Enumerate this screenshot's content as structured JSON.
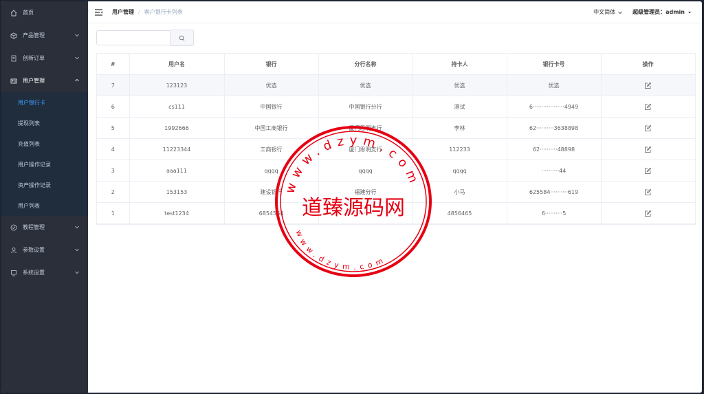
{
  "sidebar": {
    "items": [
      {
        "label": "首页",
        "icon": "home-icon"
      },
      {
        "label": "产品管理",
        "icon": "cube-icon"
      },
      {
        "label": "创新订单",
        "icon": "order-icon"
      },
      {
        "label": "用户管理",
        "icon": "user-card-icon"
      },
      {
        "label": "教程管理",
        "icon": "check-circle-icon"
      },
      {
        "label": "参数设置",
        "icon": "person-icon"
      },
      {
        "label": "系统设置",
        "icon": "monitor-icon"
      }
    ],
    "submenu": [
      "用户银行卡",
      "提现列表",
      "充值列表",
      "用户操作记录",
      "资产操作记录",
      "用户列表"
    ]
  },
  "header": {
    "breadcrumb_parent": "用户管理",
    "breadcrumb_current": "客户银行卡列表",
    "language": "中文简体",
    "admin": "超级管理员：admin"
  },
  "search": {
    "value": "",
    "placeholder": ""
  },
  "table": {
    "headers": [
      "#",
      "用户名",
      "银行",
      "分行名称",
      "持卡人",
      "银行卡号",
      "操作"
    ],
    "rows": [
      [
        "7",
        "123123",
        "优选",
        "优选",
        "优选",
        "优选"
      ],
      [
        "6",
        "cs111",
        "中国银行",
        "中国银行分行",
        "测试",
        "6··················4949"
      ],
      [
        "5",
        "1992666",
        "中国工商银行",
        "厦门思明支行",
        "李林",
        "62··········3638898"
      ],
      [
        "4",
        "11223344",
        "工商银行",
        "厦门思明支行",
        "112233",
        "62··········48898"
      ],
      [
        "3",
        "aaa111",
        "qqqq",
        "qqqq",
        "qqqq",
        "··········44"
      ],
      [
        "2",
        "153153",
        "建设银行",
        "福建分行",
        "小马",
        "625584··········619"
      ],
      [
        "1",
        "test1234",
        "6854564",
        "··········",
        "4856465",
        "6··········5"
      ]
    ]
  },
  "watermark": {
    "center_text": "道臻源码网",
    "ring_text": "www.dzym.com"
  },
  "colors": {
    "sidebar_bg": "#2b2f3a",
    "submenu_bg": "#1f2d3d",
    "active_link": "#409eff",
    "stamp_red": "#e60012"
  }
}
